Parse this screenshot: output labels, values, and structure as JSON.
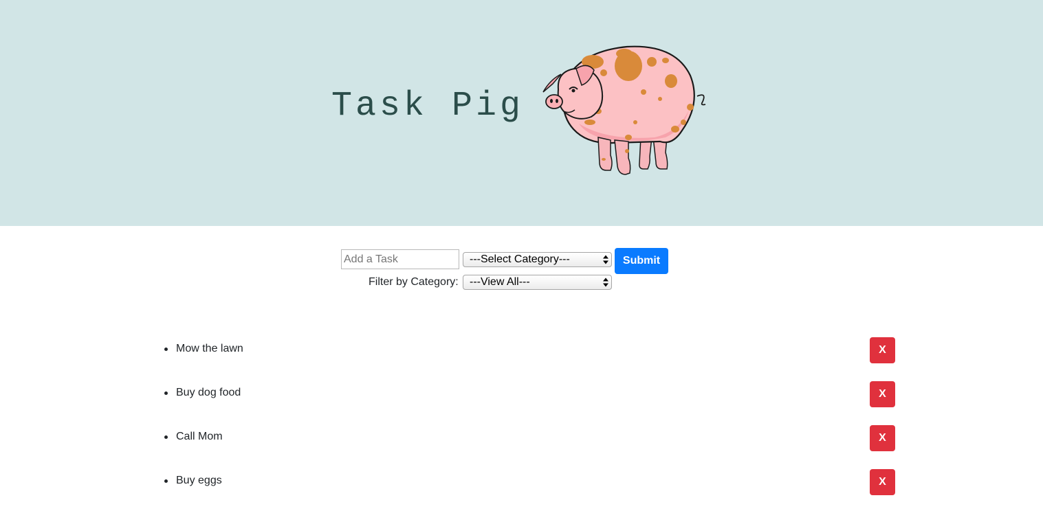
{
  "app": {
    "title": "Task Pig",
    "logo_icon": "pig-icon"
  },
  "form": {
    "task_input": {
      "value": "",
      "placeholder": "Add a Task"
    },
    "category_select": {
      "selected": "---Select Category---"
    },
    "submit_label": "Submit",
    "filter_label": "Filter by Category:",
    "filter_select": {
      "selected": "---View All---"
    }
  },
  "tasks": [
    {
      "text": "Mow the lawn",
      "delete_label": "X"
    },
    {
      "text": "Buy dog food",
      "delete_label": "X"
    },
    {
      "text": "Call Mom",
      "delete_label": "X"
    },
    {
      "text": "Buy eggs",
      "delete_label": "X"
    }
  ],
  "colors": {
    "header_bg": "#d1e5e6",
    "title_color": "#2b4d4a",
    "submit_bg": "#0a7bff",
    "delete_bg": "#e0313d"
  }
}
